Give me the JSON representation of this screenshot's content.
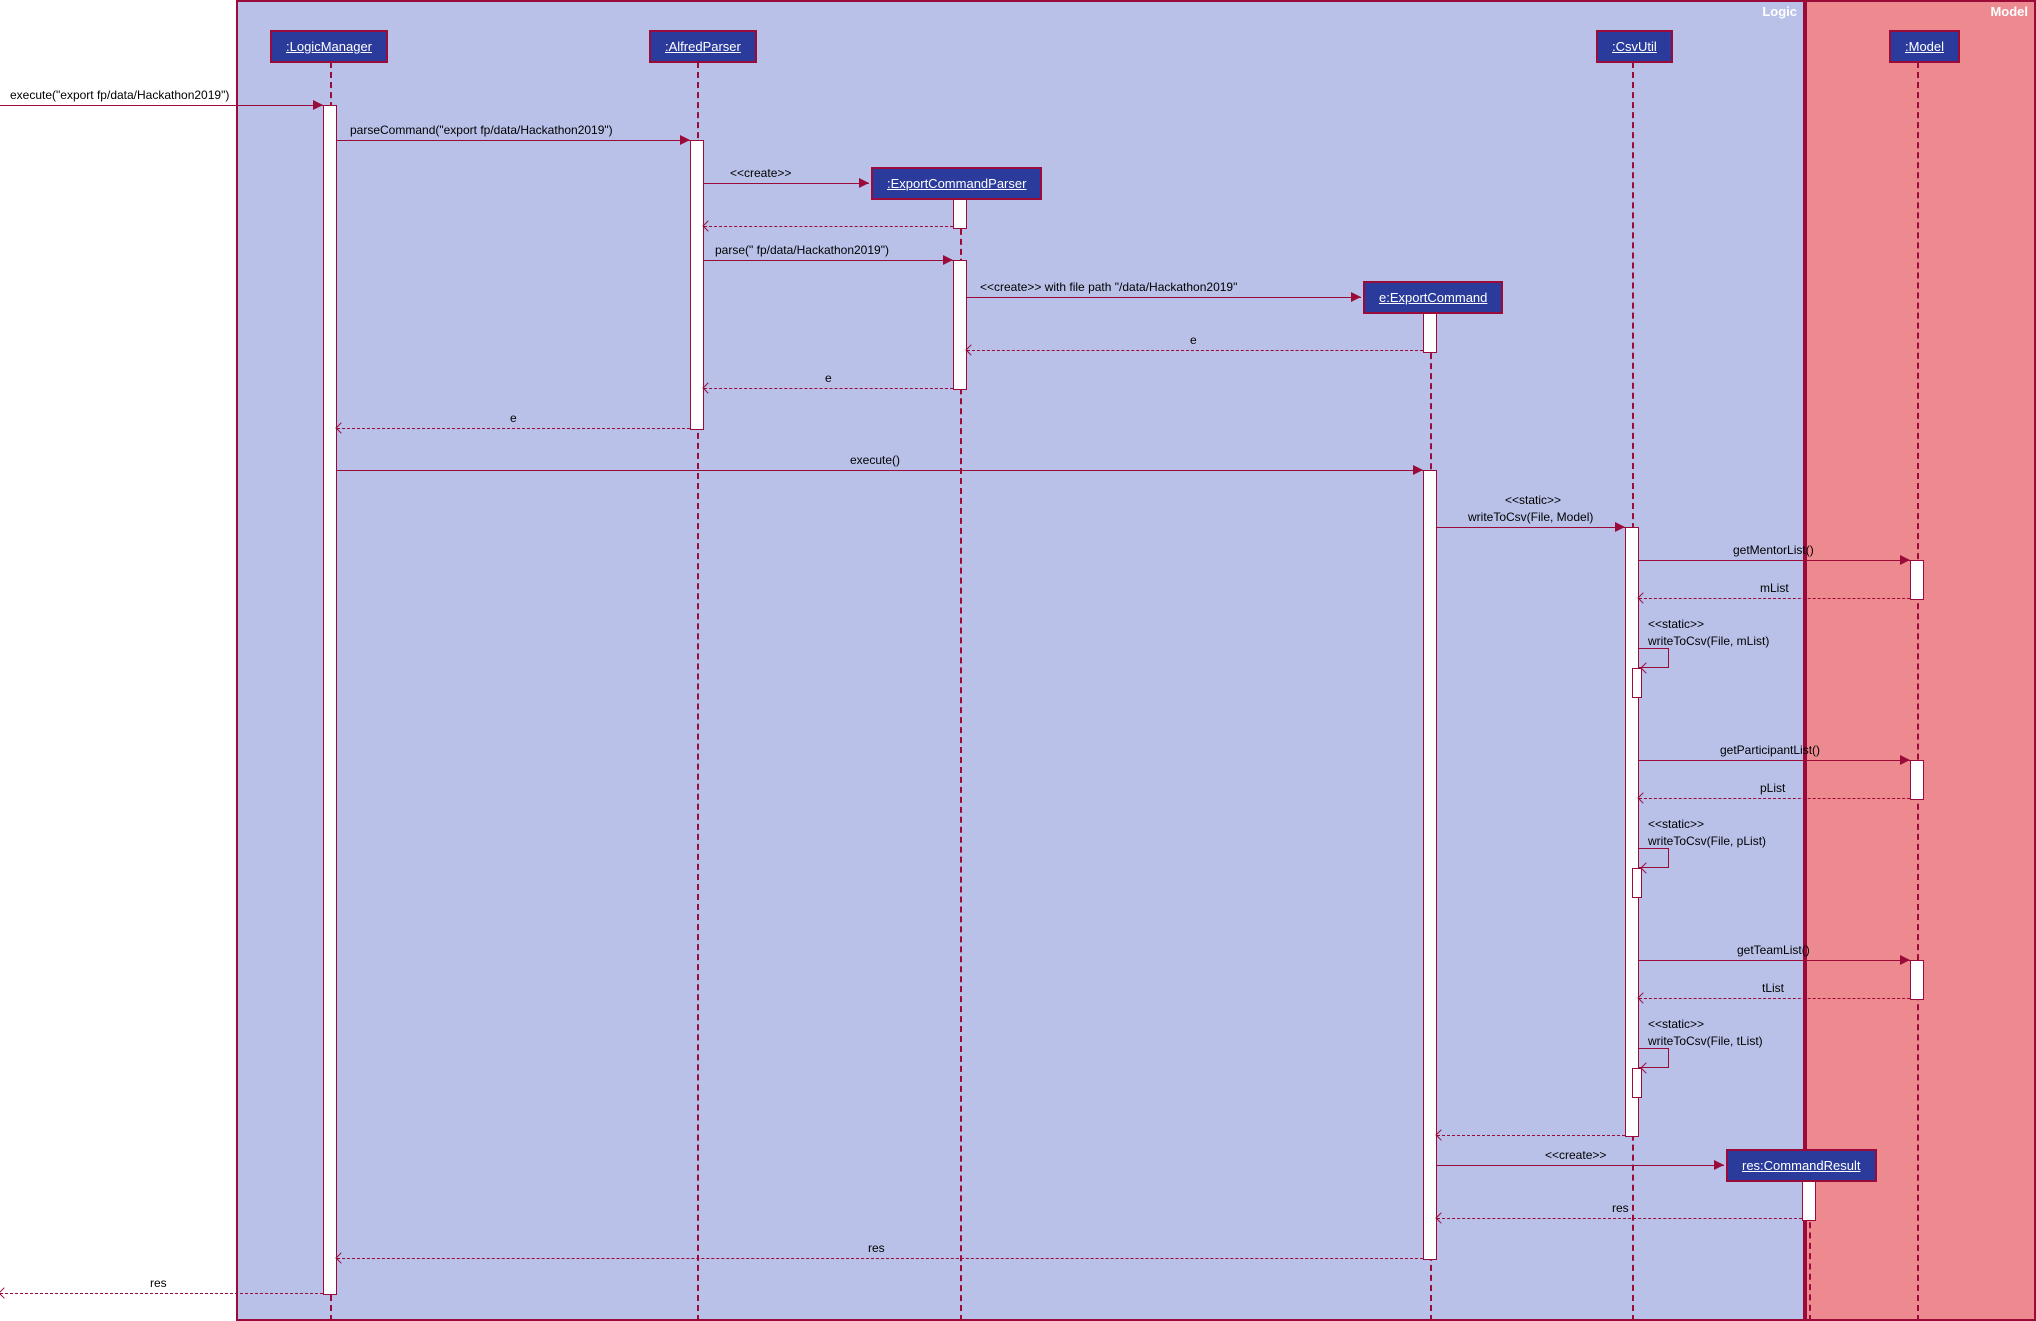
{
  "frames": {
    "logic": "Logic",
    "model": "Model"
  },
  "participants": {
    "logicManager": ":LogicManager",
    "alfredParser": ":AlfredParser",
    "exportCommandParser": ":ExportCommandParser",
    "exportCommand": "e:ExportCommand",
    "csvUtil": ":CsvUtil",
    "commandResult": "res:CommandResult",
    "model": ":Model"
  },
  "messages": {
    "m1": "execute(\"export fp/data/Hackathon2019\")",
    "m2": "parseCommand(\"export fp/data/Hackathon2019\")",
    "m3": "<<create>>",
    "m4": "parse(\" fp/data/Hackathon2019\")",
    "m5": "<<create>> with file path \"/data/Hackathon2019\"",
    "m6": "e",
    "m7": "e",
    "m8": "e",
    "m9": "execute()",
    "m10a": "<<static>>",
    "m10b": "writeToCsv(File, Model)",
    "m11": "getMentorList()",
    "m12": "mList",
    "m13a": "<<static>>",
    "m13b": "writeToCsv(File, mList)",
    "m14": "getParticipantList()",
    "m15": "pList",
    "m16a": "<<static>>",
    "m16b": "writeToCsv(File, pList)",
    "m17": "getTeamList()",
    "m18": "tList",
    "m19a": "<<static>>",
    "m19b": "writeToCsv(File, tList)",
    "m20": "<<create>>",
    "m21": "res",
    "m22": "res",
    "m23": "res"
  }
}
